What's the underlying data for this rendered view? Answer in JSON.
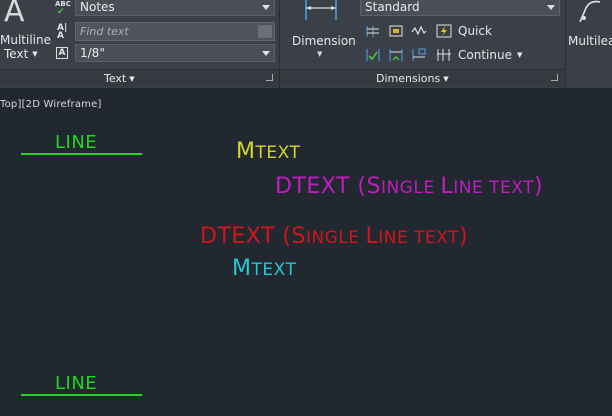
{
  "ribbon": {
    "text_panel": {
      "multiline_text_label_line1": "Multiline",
      "multiline_text_label_line2": "Text",
      "style_value": "Notes",
      "find_placeholder": "Find text",
      "height_value": "1/8\"",
      "panel_title": "Text"
    },
    "dimensions_panel": {
      "dimension_label": "Dimension",
      "style_value": "Standard",
      "quick_label": "Quick",
      "continue_label": "Continue",
      "panel_title": "Dimensions"
    },
    "leaders_panel": {
      "multileader_label": "Multilea"
    }
  },
  "viewport": {
    "label": "Top][2D Wireframe]",
    "objects": [
      {
        "name": "line-top-label",
        "text": "LINE",
        "color": "#1fd81f"
      },
      {
        "name": "mtext-yellow",
        "first": "M",
        "rest": "TEXT",
        "color": "#d6d62a"
      },
      {
        "name": "dtext-magenta",
        "first": "DTEXT (S",
        "mid1": "INGLE ",
        "l": "L",
        "mid2": "INE TEXT",
        "close": ")",
        "color": "#c01cc0"
      },
      {
        "name": "dtext-red",
        "first": "DTEXT (S",
        "mid1": "INGLE ",
        "l": "L",
        "mid2": "INE TEXT",
        "close": ")",
        "color": "#d2141e"
      },
      {
        "name": "mtext-cyan",
        "first": "M",
        "rest": "TEXT",
        "color": "#24c8d8"
      },
      {
        "name": "line-bottom-label",
        "text": "LINE",
        "color": "#1fd81f"
      }
    ]
  },
  "colors": {
    "ribbon_bg": "#3b4048",
    "canvas_bg": "#212830",
    "line_green": "#1fd81f"
  }
}
